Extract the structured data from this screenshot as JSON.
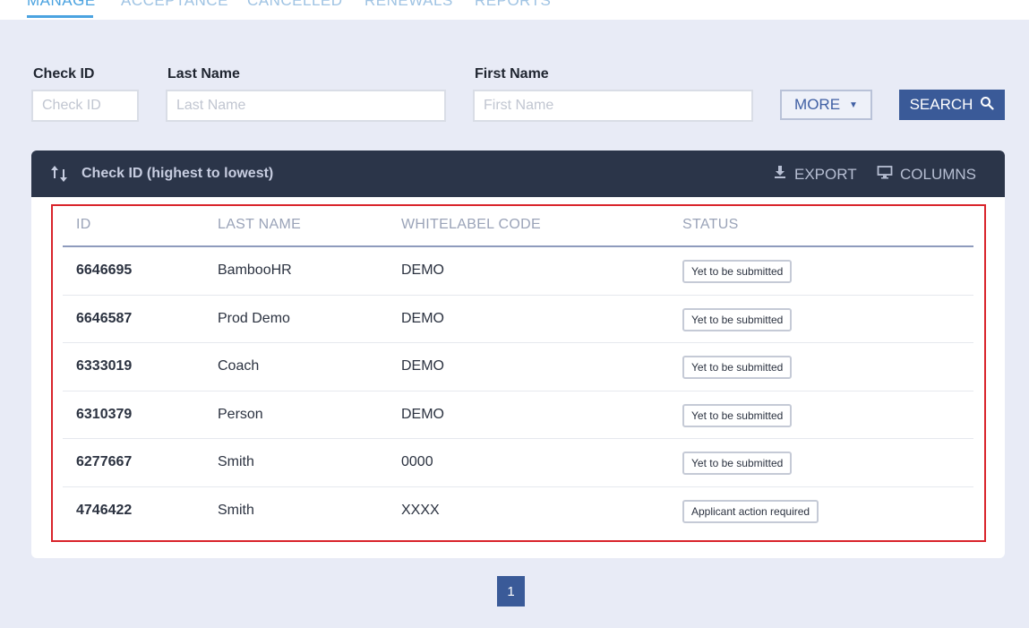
{
  "tabs": [
    {
      "label": "MANAGE",
      "active": true
    },
    {
      "label": "ACCEPTANCE",
      "active": false
    },
    {
      "label": "CANCELLED",
      "active": false
    },
    {
      "label": "RENEWALS",
      "active": false
    },
    {
      "label": "REPORTS",
      "active": false
    }
  ],
  "filters": {
    "check_id": {
      "label": "Check ID",
      "placeholder": "Check ID",
      "value": ""
    },
    "last_name": {
      "label": "Last Name",
      "placeholder": "Last Name",
      "value": ""
    },
    "first_name": {
      "label": "First Name",
      "placeholder": "First Name",
      "value": ""
    },
    "more_label": "MORE",
    "search_label": "SEARCH"
  },
  "panel": {
    "sort_label": "Check ID (highest to lowest)",
    "export_label": "EXPORT",
    "columns_label": "COLUMNS"
  },
  "table": {
    "headers": [
      "ID",
      "LAST NAME",
      "WHITELABEL CODE",
      "STATUS"
    ],
    "rows": [
      {
        "id": "6646695",
        "last_name": "BambooHR",
        "whitelabel": "DEMO",
        "status": "Yet to be submitted"
      },
      {
        "id": "6646587",
        "last_name": "Prod Demo",
        "whitelabel": "DEMO",
        "status": "Yet to be submitted"
      },
      {
        "id": "6333019",
        "last_name": "Coach",
        "whitelabel": "DEMO",
        "status": "Yet to be submitted"
      },
      {
        "id": "6310379",
        "last_name": "Person",
        "whitelabel": "DEMO",
        "status": "Yet to be submitted"
      },
      {
        "id": "6277667",
        "last_name": "Smith",
        "whitelabel": "0000",
        "status": "Yet to be submitted"
      },
      {
        "id": "4746422",
        "last_name": "Smith",
        "whitelabel": "XXXX",
        "status": "Applicant action required"
      }
    ]
  },
  "pagination": {
    "current_page": "1"
  },
  "colors": {
    "accent": "#3a5a98",
    "header_bg": "#2b3549",
    "highlight": "#d9242b",
    "page_bg": "#e8ebf6"
  }
}
